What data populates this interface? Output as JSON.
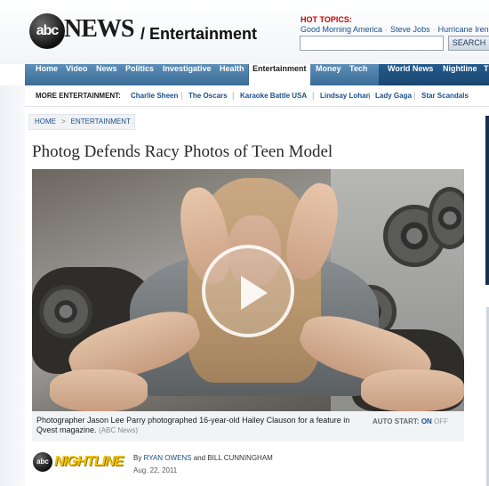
{
  "header": {
    "logo_abc": "abc",
    "logo_news": "NEWS",
    "section": "/ Entertainment",
    "hot_topics_label": "HOT TOPICS:",
    "hot_topics": [
      "Good Morning America",
      "Steve Jobs",
      "Hurricane Irene"
    ],
    "search_placeholder": "",
    "search_button": "SEARCH"
  },
  "nav": {
    "items": [
      "Home",
      "Video",
      "News",
      "Politics",
      "Investigative",
      "Health",
      "Entertainment",
      "Money",
      "Tech",
      "World News",
      "Nightline",
      "T"
    ],
    "active": "Entertainment"
  },
  "more_entertainment": {
    "label": "MORE ENTERTAINMENT:",
    "links": [
      "Charlie Sheen",
      "The Oscars",
      "Karaoke Battle USA",
      "Lindsay Lohan",
      "Lady Gaga",
      "Star Scandals"
    ]
  },
  "breadcrumb": [
    "HOME",
    "ENTERTAINMENT"
  ],
  "article": {
    "headline": "Photog Defends Racy Photos of Teen Model",
    "caption": "Photographer Jason Lee Parry photographed 16-year-old Hailey Clauson for a feature in Qvest magazine.",
    "caption_credit": "(ABC News)",
    "autostart_label": "AUTO START:",
    "autostart_on": "ON",
    "autostart_off": "OFF",
    "show_logo_abc": "abc",
    "show_logo": "NIGHTLINE",
    "byline_prefix": "By",
    "author1": "RYAN OWENS",
    "byline_and": "and",
    "author2": "BILL CUNNINGHAM",
    "date": "Aug. 22, 2011"
  },
  "colors": {
    "nav_blue": "#3b6c97",
    "link_blue": "#1a4f8b",
    "hot_red": "#cc0000"
  }
}
